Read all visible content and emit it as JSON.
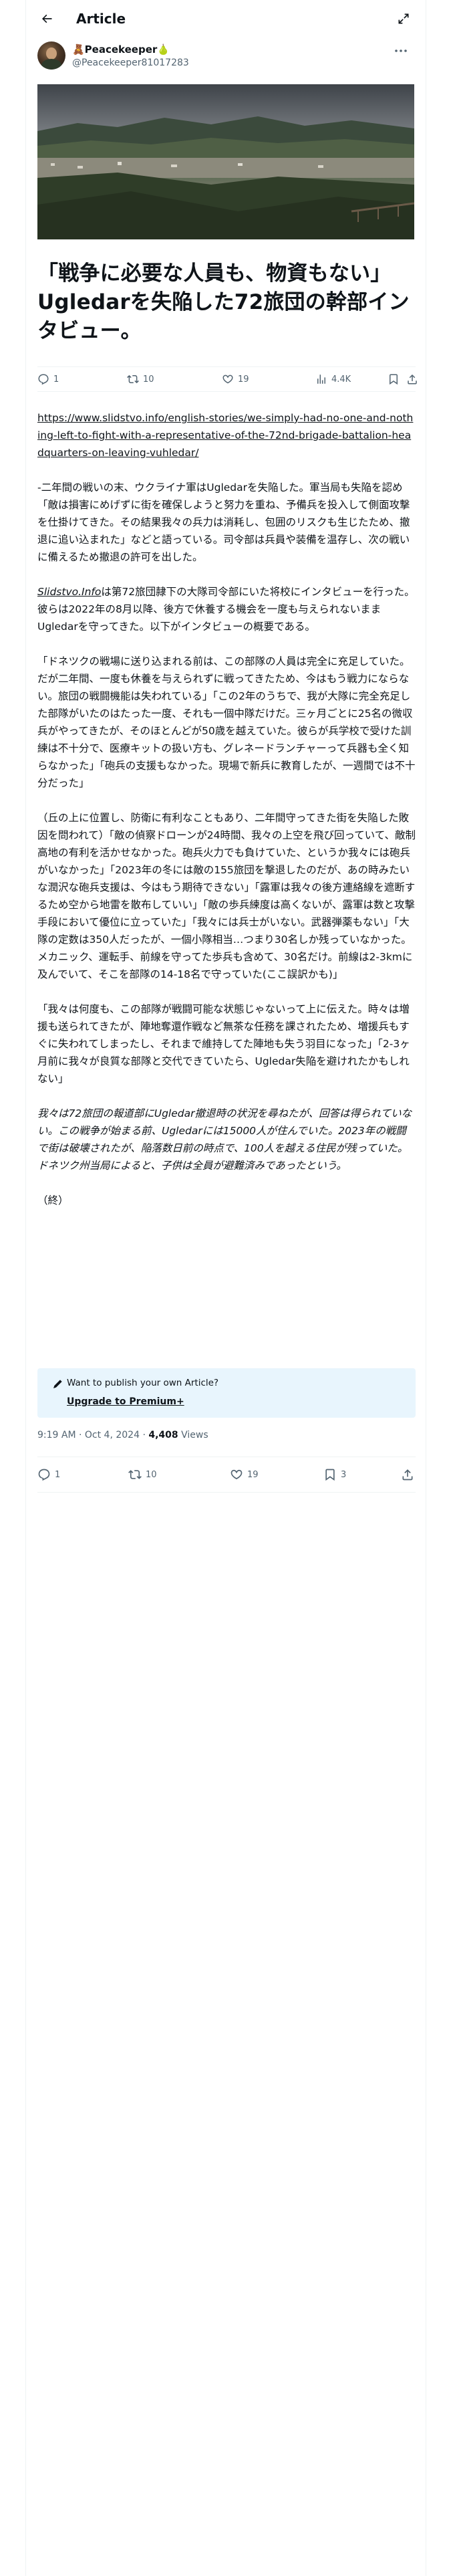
{
  "header": {
    "title": "Article"
  },
  "author": {
    "name": "🧸Peacekeeper🍐",
    "handle": "@Peacekeeper81017283"
  },
  "article": {
    "title": "「戦争に必要な人員も、物資もない」 Ugledarを失陥した72旅団の幹部インタビュー。",
    "paragraphs": [
      {
        "text": "https://www.slidstvo.info/english-stories/we-simply-had-no-one-and-nothing-left-to-fight-with-a-representative-of-the-72nd-brigade-battalion-headquarters-on-leaving-vuhledar/",
        "style": "link"
      },
      {
        "text": "-二年間の戦いの末、ウクライナ軍はUgledarを失陥した。軍当局も失陥を認め「敵は損害にめげずに街を確保しようと努力を重ね、予備兵を投入して側面攻撃を仕掛けてきた。その結果我々の兵力は消耗し、包囲のリスクも生じたため、撤退に追い込まれた」などと語っている。司令部は兵員や装備を温存し、次の戦いに備えるため撤退の許可を出した。",
        "style": "normal"
      },
      {
        "lead": "Slidstvo.Info",
        "text": "は第72旅団隷下の大隊司令部にいた将校にインタビューを行った。彼らは2022年の8月以降、後方で休養する機会を一度も与えられないままUgledarを守ってきた。以下がインタビューの概要である。",
        "style": "lead"
      },
      {
        "text": "「ドネツクの戦場に送り込まれる前は、この部隊の人員は完全に充足していた。だが二年間、一度も休養を与えられずに戦ってきたため、今はもう戦力にならない。旅団の戦闘機能は失われている」「この2年のうちで、我が大隊に完全充足した部隊がいたのはたった一度、それも一個中隊だけだ。三ヶ月ごとに25名の微収兵がやってきたが、そのほとんどが50歳を越えていた。彼らが兵学校で受けた訓練は不十分で、医療キットの扱い方も、グレネードランチャーって兵器も全く知らなかった」「砲兵の支援もなかった。現場で新兵に教育したが、一週間では不十分だった」",
        "style": "normal"
      },
      {
        "text": "（丘の上に位置し、防衛に有利なこともあり、二年間守ってきた街を失陥した敗因を問われて）「敵の偵察ドローンが24時間、我々の上空を飛び回っていて、敵制高地の有利を活かせなかった。砲兵火力でも負けていた、というか我々には砲兵がいなかった」「2023年の冬には敵の155旅団を撃退したのだが、あの時みたいな潤沢な砲兵支援は、今はもう期待できない」「露軍は我々の後方連絡線を遮断するため空から地雷を散布していい」「敵の歩兵練度は高くないが、露軍は数と攻撃手段において優位に立っていた」「我々には兵士がいない。武器弾薬もない」「大隊の定数は350人だったが、一個小隊相当…つまり30名しか残っていなかった。メカニック、運転手、前線を守ってた歩兵も含めて、30名だけ。前線は2-3kmに及んでいて、そこを部隊の14-18名で守っていた(ここ誤訳かも)」",
        "style": "normal"
      },
      {
        "text": "「我々は何度も、この部隊が戦闘可能な状態じゃないって上に伝えた。時々は増援も送られてきたが、陣地奪還作戦など無茶な任務を課されたため、増援兵もすぐに失われてしまったし、それまで維持してた陣地も失う羽目になった」「2-3ヶ月前に我々が良質な部隊と交代できていたら、Ugledar失陥を避けれたかもしれない」",
        "style": "normal"
      },
      {
        "text": "我々は72旅団の報道部にUgledar撤退時の状況を尋ねたが、回答は得られていない。この戦争が始まる前、Ugledarには15000人が住んでいた。2023年の戦闘で街は破壊されたが、陥落数日前の時点で、100人を越える住民が残っていた。ドネツク州当局によると、子供は全員が避難済みであったという。",
        "style": "italic"
      },
      {
        "text": "（終）",
        "style": "normal"
      }
    ]
  },
  "promo": {
    "text": "Want to publish your own Article?",
    "link": "Upgrade to Premium+"
  },
  "meta": {
    "time": "9:19 AM · Oct 4, 2024 · ",
    "views_count": "4,408",
    "views_label": " Views"
  },
  "stats_top": {
    "replies": "1",
    "reposts": "10",
    "likes": "19",
    "views": "4.4K"
  },
  "stats_bottom": {
    "replies": "1",
    "reposts": "10",
    "likes": "19",
    "bookmarks": "3"
  },
  "colors": {
    "text": "#0f1419",
    "secondary": "#536471",
    "promo_bg": "#e8f5fd",
    "divider": "#eff3f4"
  }
}
